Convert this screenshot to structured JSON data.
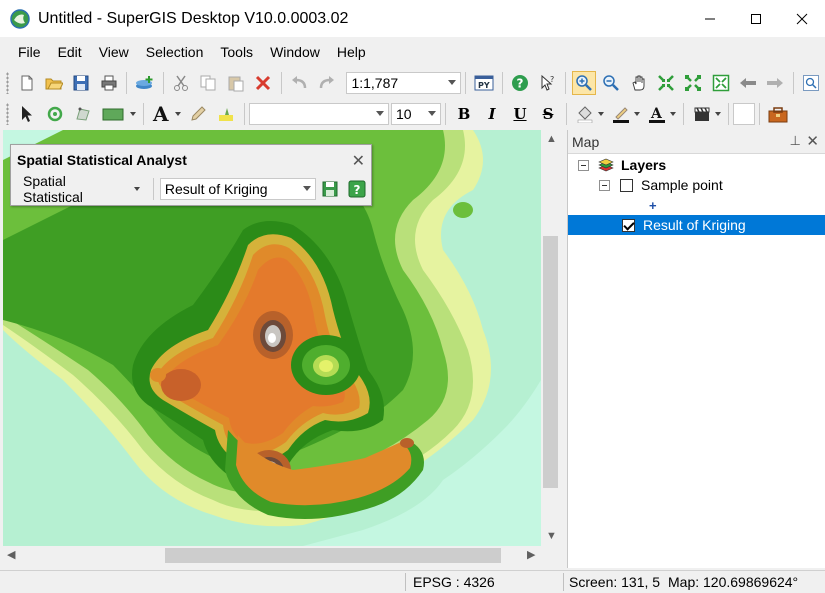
{
  "window": {
    "title": "Untitled - SuperGIS Desktop V10.0.0003.02"
  },
  "menu": {
    "items": [
      "File",
      "Edit",
      "View",
      "Selection",
      "Tools",
      "Window",
      "Help"
    ]
  },
  "toolbar1": {
    "scale_value": "1:1,787",
    "icons": [
      "new-icon",
      "open-icon",
      "save-icon",
      "print-icon",
      "add-data-icon",
      "cut-icon",
      "copy-icon",
      "paste-icon",
      "delete-icon",
      "undo-icon",
      "redo-icon",
      "python-icon",
      "help-icon",
      "whats-this-icon",
      "zoom-in-icon",
      "zoom-out-icon",
      "pan-icon",
      "fixed-zoom-in-icon",
      "fixed-zoom-out-icon",
      "full-extent-icon",
      "back-icon",
      "forward-icon",
      "zoom-layer-icon"
    ]
  },
  "toolbar2": {
    "font_size": "10",
    "bold_label": "B",
    "italic_label": "I",
    "underline_label": "U",
    "strike_label": "S"
  },
  "analyst": {
    "title": "Spatial Statistical Analyst",
    "menu_label": "Spatial Statistical",
    "layer_value": "Result of Kriging"
  },
  "panel": {
    "title": "Map",
    "layers_label": "Layers",
    "items": [
      {
        "label": "Sample point",
        "checked": false
      },
      {
        "label": "Result of Kriging",
        "checked": true
      }
    ]
  },
  "status": {
    "epsg": "EPSG : 4326",
    "screen": "Screen: 131, 5",
    "map": "Map: 120.69869624°"
  },
  "colors": {
    "selection": "#0078d7",
    "map_background": "#c4f7e1",
    "active_tool": "#fce6a8"
  }
}
